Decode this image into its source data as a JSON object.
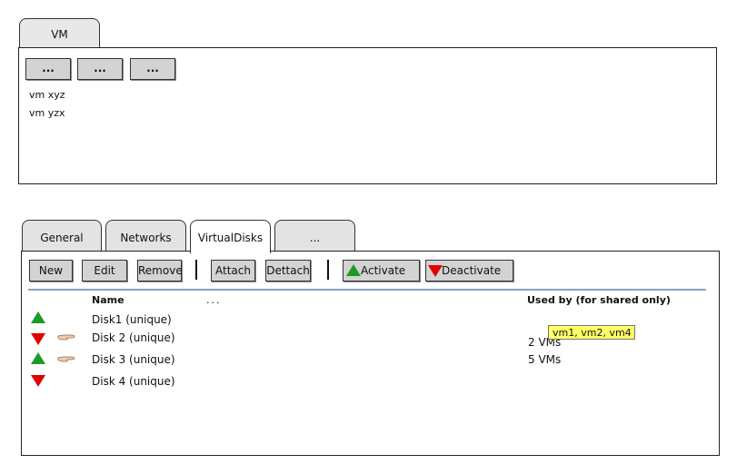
{
  "vm_panel": {
    "tab_label": "VM",
    "buttons": [
      "...",
      "...",
      "..."
    ],
    "items": [
      "vm xyz",
      "vm yzx"
    ]
  },
  "disk_panel": {
    "tabs": [
      "General",
      "Networks",
      "VirtualDisks",
      "..."
    ],
    "active_tab": "VirtualDisks",
    "toolbar": {
      "new": "New",
      "edit": "Edit",
      "remove": "Remove",
      "attach": "Attach",
      "detach": "Dettach",
      "activate": "Activate",
      "deactivate": "Deactivate"
    },
    "columns": {
      "name": "Name",
      "more": "...",
      "used_by": "Used by (for shared only)"
    },
    "rows": [
      {
        "status": "up",
        "has_hand": false,
        "name": "Disk1 (unique)",
        "used_by": ""
      },
      {
        "status": "down",
        "has_hand": true,
        "name": "Disk 2 (unique)",
        "used_by": "2 VMs"
      },
      {
        "status": "up",
        "has_hand": true,
        "name": "Disk 3 (unique)",
        "used_by": "5 VMs"
      },
      {
        "status": "down",
        "has_hand": false,
        "name": "Disk 4 (unique)",
        "used_by": ""
      }
    ],
    "tooltip": "vm1, vm2, vm4"
  },
  "colors": {
    "active": "#1a9b24",
    "inactive": "#e00000",
    "tooltip": "#ffff66",
    "separator": "#8da0c8"
  },
  "icons": {
    "active": "triangle-up-icon",
    "inactive": "triangle-down-icon",
    "pointer": "pointing-hand-icon"
  }
}
